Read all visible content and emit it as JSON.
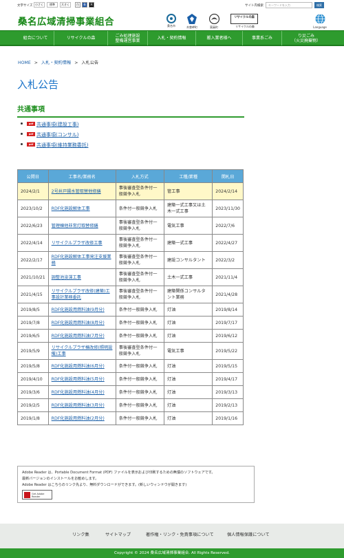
{
  "topbar": {
    "font_size_label": "文字サイズ",
    "font_small": "小さく",
    "font_normal": "標準",
    "font_large": "大きく",
    "color_white": "白",
    "color_blue": "青",
    "color_black": "黒",
    "search_label": "サイト内検索",
    "search_placeholder": "キーワードを入力",
    "search_button": "検索"
  },
  "header": {
    "site_title": "桑名広域清掃事業組合",
    "icons": [
      {
        "label": "桑名市",
        "icon": "kuwana-city-emblem-icon"
      },
      {
        "label": "木曽岬町",
        "icon": "kisosaki-town-emblem-icon"
      },
      {
        "label": "東員町",
        "icon": "toin-town-emblem-icon"
      },
      {
        "label": "リサイクルの森",
        "icon": "recycle-forest-logo"
      },
      {
        "label": "Language",
        "icon": "globe-icon"
      }
    ],
    "recycle_logo_text": "リサイクルの森"
  },
  "nav": {
    "items": [
      {
        "label": "組合について"
      },
      {
        "label": "リサイクルの森"
      },
      {
        "label": "ごみ処理施設\n整備運営事業"
      },
      {
        "label": "入札・契約情報"
      },
      {
        "label": "搬入業者様へ"
      },
      {
        "label": "事業系ごみ"
      },
      {
        "label": "り災ごみ\n（火災廃棄物）"
      }
    ]
  },
  "breadcrumb": {
    "home": "HOME",
    "sep": ">",
    "level1": "入札・契約情報",
    "current": "入札公告"
  },
  "page_title": "入札公告",
  "section_title": "共通事項",
  "common_links": [
    {
      "label": "共通事項(建設工事)",
      "badge": "pdf"
    },
    {
      "label": "共通事項(コンサル)",
      "badge": "pdf"
    },
    {
      "label": "共通事項(維持業務委託)",
      "badge": "pdf"
    }
  ],
  "table": {
    "headers": [
      "公開日",
      "工事名/業務名",
      "入札方式",
      "工種/業種",
      "開札日"
    ],
    "rows": [
      {
        "date": "2024/2/1",
        "name": "2号井戸揚水管取替他修繕",
        "method": "事後審査型条件付一般競争入札",
        "type": "管工事",
        "open": "2024/2/14",
        "highlight": true
      },
      {
        "date": "2023/10/2",
        "name": "RDF化施設解体工事",
        "method": "条件付一般競争入札",
        "type": "建築一式工事又は土木一式工事",
        "open": "2023/11/30"
      },
      {
        "date": "2022/6/23",
        "name": "管理棟他非常灯取替修繕",
        "method": "事後審査型条件付一般競争入札",
        "type": "電気工事",
        "open": "2022/7/6"
      },
      {
        "date": "2022/4/14",
        "name": "リサイクルプラザ改修工事",
        "method": "事後審査型条件付一般競争入札",
        "type": "建築一式工事",
        "open": "2022/4/27"
      },
      {
        "date": "2022/2/17",
        "name": "RDF化施設解体工事発注支援業務",
        "method": "事後審査型条件付一般競争入札",
        "type": "建設コンサルタント",
        "open": "2022/3/2"
      },
      {
        "date": "2021/10/21",
        "name": "調整池浚渫工事",
        "method": "事後審査型条件付一般競争入札",
        "type": "土木一式工事",
        "open": "2021/11/4"
      },
      {
        "date": "2021/4/15",
        "name": "リサイクルプラザ改修(建築)工事設計業務委託",
        "method": "事後審査型条件付一般競争入札",
        "type": "建築関係コンサルタント業務",
        "open": "2021/4/28"
      },
      {
        "date": "2019/8/5",
        "name": "RDF化施設用燃料油(9月分)",
        "method": "条件付一般競争入札",
        "type": "灯油",
        "open": "2019/8/14"
      },
      {
        "date": "2019/7/8",
        "name": "RDF化施設用燃料油(8月分)",
        "method": "条件付一般競争入札",
        "type": "灯油",
        "open": "2019/7/17"
      },
      {
        "date": "2019/6/5",
        "name": "RDF化施設用燃料油(7月分)",
        "method": "条件付一般競争入札",
        "type": "灯油",
        "open": "2019/6/12"
      },
      {
        "date": "2019/5/9",
        "name": "リサイクルプラザ棟改修(照明設備)工事",
        "method": "事後審査型条件付一般競争入札",
        "type": "電気工事",
        "open": "2019/5/22"
      },
      {
        "date": "2019/5/8",
        "name": "RDF化施設用燃料油(6月分)",
        "method": "条件付一般競争入札",
        "type": "灯油",
        "open": "2019/5/15"
      },
      {
        "date": "2019/4/10",
        "name": "RDF化施設用燃料油(5月分)",
        "method": "条件付一般競争入札",
        "type": "灯油",
        "open": "2019/4/17"
      },
      {
        "date": "2019/3/6",
        "name": "RDF化施設用燃料油(4月分)",
        "method": "条件付一般競争入札",
        "type": "灯油",
        "open": "2019/3/13"
      },
      {
        "date": "2019/2/5",
        "name": "RDF化施設用燃料油(3月分)",
        "method": "条件付一般競争入札",
        "type": "灯油",
        "open": "2019/2/13"
      },
      {
        "date": "2019/1/8",
        "name": "RDF化施設用燃料油(2月分)",
        "method": "条件付一般競争入札",
        "type": "灯油",
        "open": "2019/1/16"
      }
    ]
  },
  "adobe": {
    "line1": "Adobe Reader は、Portable Document Format (PDF) ファイルを表示および印刷するための無償のソフトウェアです。",
    "line2": "最新バージョンのインストールをお勧めします。",
    "line3": "Adobe Reader はこちらのリンク先より、無料ダウンロードができます。(新しいウィンドウが開きます)",
    "get_button_text": "Get Adobe Reader"
  },
  "footer": {
    "links": [
      "リンク集",
      "サイトマップ",
      "著作権・リンク・免責事項について",
      "個人情報保護について"
    ],
    "copyright": "Copyright © 2024 桑名広域清掃事業組合. All Rights Reserved."
  },
  "colors": {
    "brand_green": "#2e9b2e",
    "link_blue": "#1a5fa8",
    "title_blue": "#1a73c9",
    "table_header": "#5aa8d8",
    "highlight_row": "#fff8c8"
  }
}
